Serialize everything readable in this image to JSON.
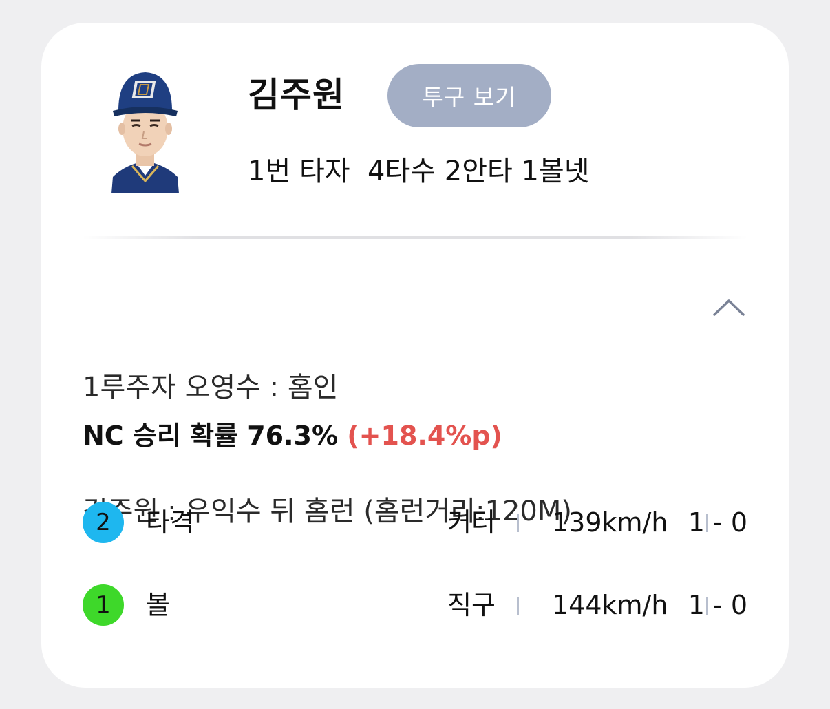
{
  "player": {
    "name": "김주원",
    "avatar_icon": "player-photo-icon",
    "batting_line": "1번 타자  4타수 2안타 1볼넷"
  },
  "pitch_button_label": "투구 보기",
  "play": {
    "line1": "1루주자 오영수 : 홈인",
    "line2": "김주원 : 우익수 뒤 홈런 (홈런거리:120M)",
    "collapse_icon": "chevron-up-icon"
  },
  "win_probability": {
    "label": "NC 승리 확률 76.3%",
    "delta": "(+18.4%p)",
    "delta_color": "#e3534f"
  },
  "pitches": [
    {
      "number": "2",
      "badge_color": "#1eb7ef",
      "result": "타격",
      "pitch_type": "커터",
      "speed": "139km/h",
      "count": "1 - 0"
    },
    {
      "number": "1",
      "badge_color": "#3ed82a",
      "result": "볼",
      "pitch_type": "직구",
      "speed": "144km/h",
      "count": "1 - 0"
    }
  ]
}
